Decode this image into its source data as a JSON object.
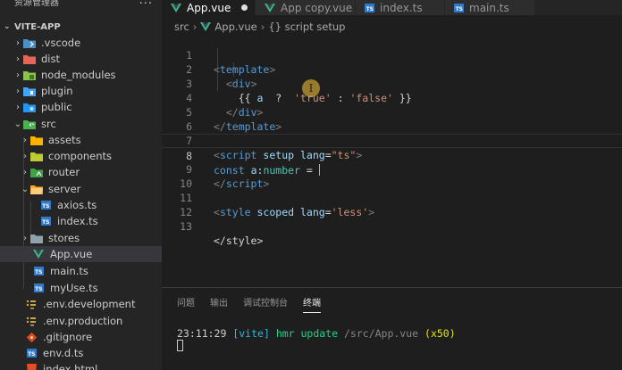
{
  "sidebar": {
    "title": "资源管理器",
    "more": "···",
    "project": "VITE-APP",
    "items": [
      {
        "label": ".vscode",
        "icon": "vscode-folder-icon"
      },
      {
        "label": "dist",
        "icon": "dist-folder-icon"
      },
      {
        "label": "node_modules",
        "icon": "node-modules-folder-icon"
      },
      {
        "label": "plugin",
        "icon": "plugin-folder-icon"
      },
      {
        "label": "public",
        "icon": "public-folder-icon"
      },
      {
        "label": "src",
        "icon": "src-folder-icon"
      },
      {
        "label": "assets",
        "icon": "assets-folder-icon"
      },
      {
        "label": "components",
        "icon": "components-folder-icon"
      },
      {
        "label": "router",
        "icon": "router-folder-icon"
      },
      {
        "label": "server",
        "icon": "server-folder-icon"
      },
      {
        "label": "axios.ts",
        "icon": "typescript-file-icon",
        "badge": "TS"
      },
      {
        "label": "index.ts",
        "icon": "typescript-file-icon",
        "badge": "TS"
      },
      {
        "label": "stores",
        "icon": "stores-folder-icon"
      },
      {
        "label": "App.vue",
        "icon": "vue-file-icon"
      },
      {
        "label": "main.ts",
        "icon": "typescript-file-icon",
        "badge": "TS"
      },
      {
        "label": "myUse.ts",
        "icon": "typescript-file-icon",
        "badge": "TS"
      },
      {
        "label": ".env.development",
        "icon": "env-file-icon"
      },
      {
        "label": ".env.production",
        "icon": "env-file-icon"
      },
      {
        "label": ".gitignore",
        "icon": "git-file-icon"
      },
      {
        "label": "env.d.ts",
        "icon": "typescript-file-icon",
        "badge": "TS"
      },
      {
        "label": "index.html",
        "icon": "html-file-icon"
      }
    ]
  },
  "tabs": [
    {
      "label": "App.vue",
      "icon": "vue-file-icon",
      "active": true,
      "modified": true
    },
    {
      "label": "App copy.vue",
      "icon": "vue-file-icon",
      "active": false
    },
    {
      "label": "index.ts",
      "icon": "typescript-file-icon",
      "badge": "TS",
      "active": false
    },
    {
      "label": "main.ts",
      "icon": "typescript-file-icon",
      "badge": "TS",
      "active": false
    }
  ],
  "breadcrumb": {
    "folder": "src",
    "file": "App.vue",
    "symbol": "{} script setup"
  },
  "code": {
    "line_numbers": [
      "1",
      "2",
      "3",
      "4",
      "5",
      "6",
      "7",
      "8",
      "9",
      "10",
      "11",
      "12",
      "13"
    ],
    "current_line": "8"
  },
  "panel": {
    "tabs": [
      "问题",
      "输出",
      "调试控制台",
      "终端"
    ],
    "active_tab": "终端",
    "terminal": {
      "time": "23:11:29",
      "tag": "[vite]",
      "message": "hmr update",
      "path": "/src/App.vue",
      "count": "(x50)"
    }
  },
  "colors": {
    "background": "#1e1e1e",
    "sidebar": "#252526",
    "keyword": "#569cd6",
    "string": "#ce9178",
    "vue": "#41b883",
    "typescript": "#3178c6"
  }
}
